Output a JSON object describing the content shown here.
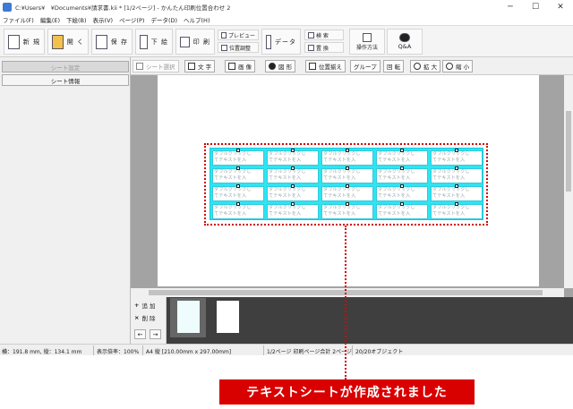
{
  "window": {
    "title": "C:¥Users¥　¥Documents¥請求書.kii * [1/2ページ] - かんたん印刷位置合わせ 2",
    "minimize": "─",
    "maximize": "☐",
    "close": "✕"
  },
  "menu": [
    "ファイル(F)",
    "編集(E)",
    "下絵(B)",
    "表示(V)",
    "ページ(P)",
    "データ(D)",
    "ヘルプ(H)"
  ],
  "toolbar": {
    "new_label": "新 規",
    "open_label": "開 く",
    "save_label": "保 存",
    "underlay_label": "下 絵",
    "print_label": "印 刷",
    "preview_label": "プレビュー",
    "position_label": "位置調整",
    "data_label": "データ",
    "search_label": "検 索",
    "replace_label": "置 換",
    "howto_label": "操作方法",
    "qa_label": "Q&A"
  },
  "left_panel": {
    "tab_sheet_settings": "シート設定",
    "tab_sheet_info": "シート情報"
  },
  "object_toolbar": {
    "select": "シート選択",
    "text": "文 字",
    "image": "画 像",
    "shape": "図 形",
    "align": "位置揃え",
    "group": "グループ",
    "rotate": "回 転",
    "zoom_in": "拡 大",
    "zoom_out": "縮 小"
  },
  "grid": {
    "rows": 4,
    "cols": 5,
    "cell_text_line1": "ダブルクリックし",
    "cell_text_line2": "てテキストを入"
  },
  "page_strip": {
    "add_label": "追 加",
    "delete_label": "削 除",
    "prev": "←",
    "next": "→"
  },
  "status": {
    "position": "横：191.8 mm, 縦：134.1 mm",
    "zoom": "表示倍率：100%",
    "paper": "A4 縦 [210.00mm x 297.00mm]",
    "page": "1/2ページ 印刷ページ合計 2ページ",
    "objects": "20/20オブジェクト"
  },
  "callout": {
    "message": "テキストシートが作成されました"
  },
  "colors": {
    "accent_red": "#d90000",
    "grid_cyan": "#2ee5f0"
  }
}
